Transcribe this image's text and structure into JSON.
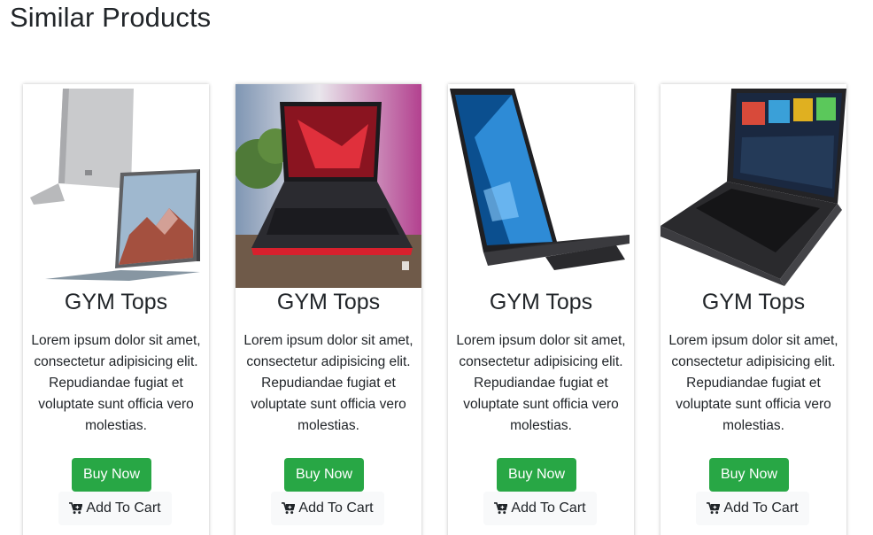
{
  "section": {
    "title": "Similar Products"
  },
  "products": [
    {
      "title": "GYM Tops",
      "description": "Lorem ipsum dolor sit amet, consectetur adipisicing elit. Repudiandae fugiat et voluptate sunt officia vero molestias.",
      "buy_label": "Buy Now",
      "cart_label": "Add To Cart",
      "image": "surface-tablet-laptop"
    },
    {
      "title": "GYM Tops",
      "description": "Lorem ipsum dolor sit amet, consectetur adipisicing elit. Repudiandae fugiat et voluptate sunt officia vero molestias.",
      "buy_label": "Buy Now",
      "cart_label": "Add To Cart",
      "image": "gaming-laptop-red"
    },
    {
      "title": "GYM Tops",
      "description": "Lorem ipsum dolor sit amet, consectetur adipisicing elit. Repudiandae fugiat et voluptate sunt officia vero molestias.",
      "buy_label": "Buy Now",
      "cart_label": "Add To Cart",
      "image": "windows-laptop-black"
    },
    {
      "title": "GYM Tops",
      "description": "Lorem ipsum dolor sit amet, consectetur adipisicing elit. Repudiandae fugiat et voluptate sunt officia vero molestias.",
      "buy_label": "Buy Now",
      "cart_label": "Add To Cart",
      "image": "workstation-laptop"
    }
  ],
  "colors": {
    "buy_button": "#28a745",
    "cart_button": "#f8f9fa",
    "text": "#212529"
  },
  "icons": {
    "cart": "cart-plus-icon"
  }
}
